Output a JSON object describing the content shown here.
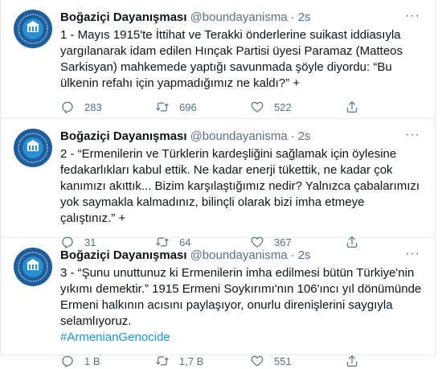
{
  "tweets": [
    {
      "name": "Boğaziçi Dayanışması",
      "handle": "@boundayanisma",
      "separator": "·",
      "time": "2s",
      "more": "···",
      "text": "1 - Mayıs 1915'te İttihat ve Terakki önderlerine suikast iddiasıyla yargılanarak idam edilen Hınçak Partisi üyesi Paramaz (Matteos Sarkisyan) mahkemede yaptığı savunmada şöyle diyordu: “Bu ülkenin refahı için yapmadığımız ne kaldı?” +",
      "hashtag": "",
      "replies": "283",
      "retweets": "696",
      "likes": "522"
    },
    {
      "name": "Boğaziçi Dayanışması",
      "handle": "@boundayanisma",
      "separator": "·",
      "time": "2s",
      "more": "···",
      "text": "2 - “Ermenilerin ve Türklerin kardeşliğini sağlamak için öylesine fedakarlıkları kabul ettik. Ne kadar enerji tükettik, ne kadar çok kanımızı akıttık... Bizim karşılaştığımız nedir? Yalnızca çabalarımızı yok saymakla kalmadınız, bilinçli olarak bizi imha etmeye çalıştınız.” +",
      "hashtag": "",
      "replies": "31",
      "retweets": "64",
      "likes": "367"
    },
    {
      "name": "Boğaziçi Dayanışması",
      "handle": "@boundayanisma",
      "separator": "·",
      "time": "2s",
      "more": "···",
      "text": "3 - “Şunu unuttunuz ki Ermenilerin imha edilmesi bütün Türkiye'nin yıkımı demektir.” 1915 Ermeni Soykırımı'nın 106'ıncı yıl dönümünde Ermeni halkının acısını paylaşıyor, onurlu direnişlerini saygıyla selamlıyoruz.",
      "hashtag": "#ArmenianGenocide",
      "replies": "1 B",
      "retweets": "1,7 B",
      "likes": "551"
    }
  ],
  "icons": {
    "reply": "reply-icon",
    "retweet": "retweet-icon",
    "like": "heart-icon",
    "share": "share-icon",
    "more": "more-icon"
  },
  "colors": {
    "text": "#0f1419",
    "muted": "#5b7083",
    "link": "#1b95e0",
    "border": "#e6ecf0"
  }
}
